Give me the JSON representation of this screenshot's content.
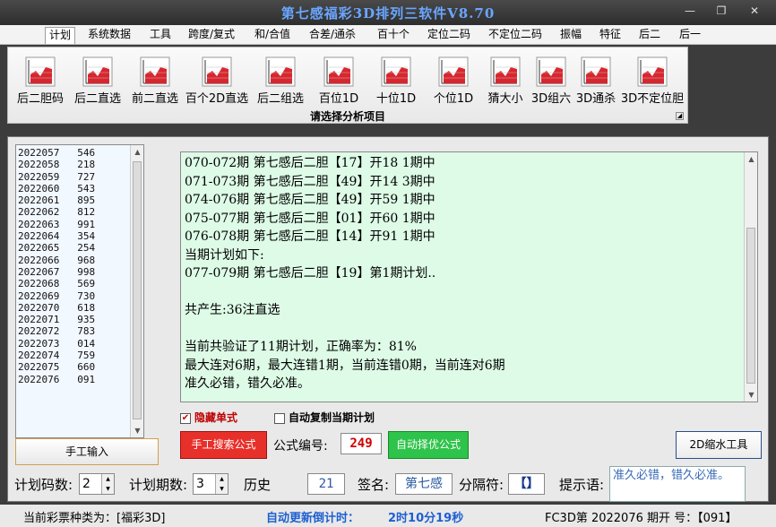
{
  "window": {
    "title": "第七感福彩3D排列三软件V8.70",
    "min": "—",
    "max": "❐",
    "close": "✕"
  },
  "ribbon": {
    "tabs": [
      "计划",
      "系统数据",
      "工具",
      "跨度/复式",
      "和/合值",
      "合差/通杀",
      "百十个",
      "定位二码",
      "不定位二码",
      "振幅",
      "特征",
      "后二",
      "后一"
    ],
    "active_tab": "计划",
    "buttons": [
      "后二胆码",
      "后二直选",
      "前二直选",
      "百个2D直选",
      "后二组选",
      "百位1D",
      "十位1D",
      "个位1D",
      "猜大小",
      "3D组六",
      "3D通杀",
      "3D不定位胆"
    ],
    "group_label": "请选择分析项目"
  },
  "history": {
    "rows": [
      {
        "issue": "2022057",
        "num": "546"
      },
      {
        "issue": "2022058",
        "num": "218"
      },
      {
        "issue": "2022059",
        "num": "727"
      },
      {
        "issue": "2022060",
        "num": "543"
      },
      {
        "issue": "2022061",
        "num": "895"
      },
      {
        "issue": "2022062",
        "num": "812"
      },
      {
        "issue": "2022063",
        "num": "991"
      },
      {
        "issue": "2022064",
        "num": "354"
      },
      {
        "issue": "2022065",
        "num": "254"
      },
      {
        "issue": "2022066",
        "num": "968"
      },
      {
        "issue": "2022067",
        "num": "998"
      },
      {
        "issue": "2022068",
        "num": "569"
      },
      {
        "issue": "2022069",
        "num": "730"
      },
      {
        "issue": "2022070",
        "num": "618"
      },
      {
        "issue": "2022071",
        "num": "935"
      },
      {
        "issue": "2022072",
        "num": "783"
      },
      {
        "issue": "2022073",
        "num": "014"
      },
      {
        "issue": "2022074",
        "num": "759"
      },
      {
        "issue": "2022075",
        "num": "660"
      },
      {
        "issue": "2022076",
        "num": "091"
      }
    ],
    "manual_input_label": "手工输入"
  },
  "results": {
    "lines": [
      "070-072期 第七感后二胆【17】开18 1期中",
      "071-073期 第七感后二胆【49】开14 3期中",
      "074-076期 第七感后二胆【49】开59 1期中",
      "075-077期 第七感后二胆【01】开60 1期中",
      "076-078期 第七感后二胆【14】开91 1期中",
      "当期计划如下:",
      "077-079期 第七感后二胆【19】第1期计划..",
      "",
      "共产生:36注直选",
      "",
      "当前共验证了11期计划，正确率为：81%",
      "最大连对6期，最大连错1期，当前连错0期，当前连对6期",
      "准久必错，错久必准。"
    ]
  },
  "options": {
    "hide_single_label": "隐藏单式",
    "hide_single_checked": "✔",
    "auto_copy_label": "自动复制当期计划"
  },
  "actions": {
    "search_formula": "手工搜索公式",
    "formula_no_label": "公式编号:",
    "formula_no": "249",
    "auto_pick": "自动择优公式",
    "shrink_2d": "2D缩水工具"
  },
  "settings": {
    "plan_code_count_label": "计划码数:",
    "plan_code_count": "2",
    "plan_period_label": "计划期数:",
    "plan_period": "3",
    "history_label": "历史",
    "history_value": "21",
    "signature_label": "签名:",
    "signature": "第七感",
    "separator_label": "分隔符:",
    "separator": "【】",
    "hint_label": "提示语:",
    "hint": "准久必错，错久必准。"
  },
  "status": {
    "lottery_type": "当前彩票种类为：[福彩3D]",
    "countdown_label": "自动更新倒计时：",
    "countdown_value": "2时10分19秒",
    "issue_info": "FC3D第 2022076 期开  号：【091】"
  }
}
